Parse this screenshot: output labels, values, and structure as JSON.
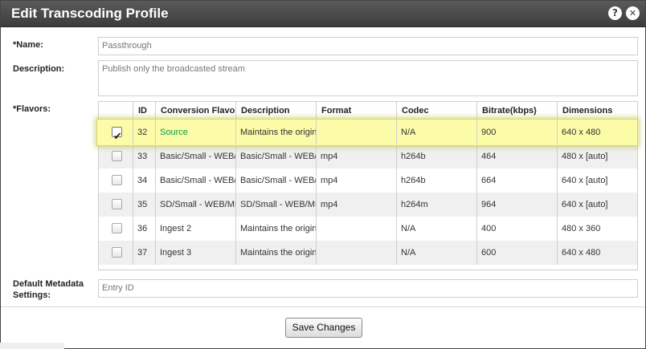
{
  "dialog": {
    "title": "Edit Transcoding Profile",
    "help_glyph": "?",
    "close_glyph": "✕"
  },
  "form": {
    "name_label": "*Name:",
    "name_value": "Passthrough",
    "description_label": "Description:",
    "description_value": "Publish only the broadcasted stream",
    "flavors_label": "*Flavors:",
    "metadata_label_line1": "Default Metadata",
    "metadata_label_line2": "Settings:",
    "metadata_placeholder": "Entry ID"
  },
  "table": {
    "columns": [
      "",
      "ID",
      "Conversion Flavor",
      "Description",
      "Format",
      "Codec",
      "Bitrate(kbps)",
      "Dimensions"
    ],
    "rows": [
      {
        "checked": true,
        "id": "32",
        "flavor": "Source",
        "description": "Maintains the original",
        "format": "",
        "codec": "N/A",
        "bitrate": "900",
        "dimensions": "640 x 480"
      },
      {
        "checked": false,
        "id": "33",
        "flavor": "Basic/Small - WEB/MBL",
        "description": "Basic/Small - WEB/MBL",
        "format": "mp4",
        "codec": "h264b",
        "bitrate": "464",
        "dimensions": "480 x [auto]"
      },
      {
        "checked": false,
        "id": "34",
        "flavor": "Basic/Small - WEB/MBL",
        "description": "Basic/Small - WEB/MBL",
        "format": "mp4",
        "codec": "h264b",
        "bitrate": "664",
        "dimensions": "640 x [auto]"
      },
      {
        "checked": false,
        "id": "35",
        "flavor": "SD/Small - WEB/MBL",
        "description": "SD/Small - WEB/MBL",
        "format": "mp4",
        "codec": "h264m",
        "bitrate": "964",
        "dimensions": "640 x [auto]"
      },
      {
        "checked": false,
        "id": "36",
        "flavor": "Ingest 2",
        "description": "Maintains the original",
        "format": "",
        "codec": "N/A",
        "bitrate": "400",
        "dimensions": "480 x 360"
      },
      {
        "checked": false,
        "id": "37",
        "flavor": "Ingest 3",
        "description": "Maintains the original",
        "format": "",
        "codec": "N/A",
        "bitrate": "600",
        "dimensions": "640 x 480"
      }
    ],
    "check_glyph": "✔"
  },
  "actions": {
    "save_label": "Save Changes"
  },
  "colors": {
    "highlight": "#fbfba8",
    "source_link": "#00a24a",
    "titlebar": "#4a4a4a"
  }
}
